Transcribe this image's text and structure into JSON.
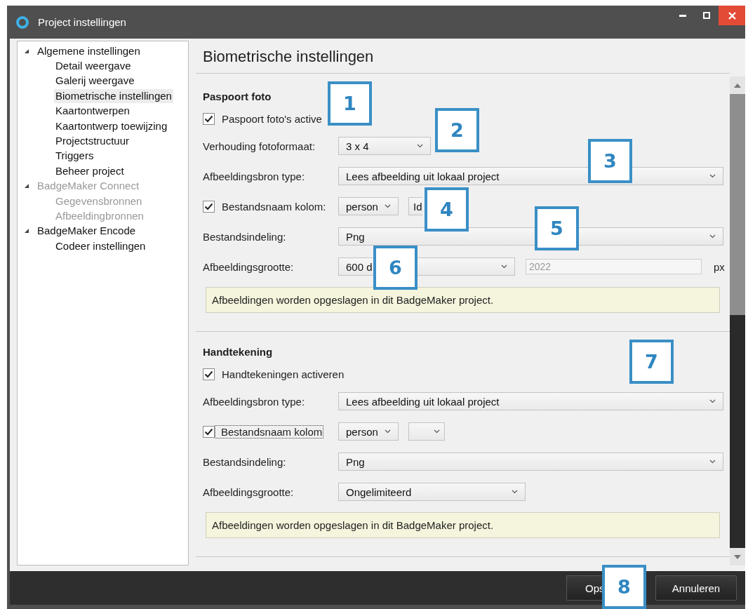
{
  "window": {
    "title": "Project instellingen"
  },
  "tree": [
    {
      "label": "Algemene instellingen",
      "expanded": true,
      "disabled": false,
      "selected": false,
      "children": [
        {
          "label": "Detail weergave",
          "disabled": false,
          "selected": false
        },
        {
          "label": "Galerij weergave",
          "disabled": false,
          "selected": false
        },
        {
          "label": "Biometrische instellingen",
          "disabled": false,
          "selected": true
        },
        {
          "label": "Kaartontwerpen",
          "disabled": false,
          "selected": false
        },
        {
          "label": "Kaartontwerp toewijzing",
          "disabled": false,
          "selected": false
        },
        {
          "label": "Projectstructuur",
          "disabled": false,
          "selected": false
        },
        {
          "label": "Triggers",
          "disabled": false,
          "selected": false
        },
        {
          "label": "Beheer project",
          "disabled": false,
          "selected": false
        }
      ]
    },
    {
      "label": "BadgeMaker Connect",
      "expanded": true,
      "disabled": true,
      "selected": false,
      "children": [
        {
          "label": "Gegevensbronnen",
          "disabled": true,
          "selected": false
        },
        {
          "label": "Afbeeldingbronnen",
          "disabled": true,
          "selected": false
        }
      ]
    },
    {
      "label": "BadgeMaker Encode",
      "expanded": true,
      "disabled": false,
      "selected": false,
      "children": [
        {
          "label": "Codeer instellingen",
          "disabled": false,
          "selected": false
        }
      ]
    }
  ],
  "heading": "Biometrische instellingen",
  "sections": [
    {
      "title": "Paspoort foto",
      "rows": [
        {
          "kind": "checkbox",
          "label": "Paspoort foto's active",
          "checked": true
        },
        {
          "kind": "short-select",
          "label": "Verhouding fotoformaat:",
          "value": "3 x 4"
        },
        {
          "kind": "wide-select",
          "label": "Afbeeldingsbron type:",
          "value": "Lees afbeelding uit lokaal project"
        },
        {
          "kind": "checkbox-select",
          "label": "Bestandsnaam kolom:",
          "checked": true,
          "focused": false,
          "selects": [
            {
              "kind": "filled",
              "value": "person"
            },
            {
              "kind": "filled",
              "value": "Id"
            }
          ]
        },
        {
          "kind": "wide-select",
          "label": "Bestandsindeling:",
          "value": "Png"
        },
        {
          "kind": "select-input",
          "label": "Afbeeldingsgrootte:",
          "value": "600 d",
          "input_value": "2022",
          "input_disabled": true,
          "unit": "px"
        },
        {
          "kind": "note",
          "text": "Afbeeldingen worden opgeslagen in dit BadgeMaker project."
        }
      ]
    },
    {
      "title": "Handtekening",
      "rows": [
        {
          "kind": "checkbox",
          "label": "Handtekeningen activeren",
          "checked": true
        },
        {
          "kind": "wide-select",
          "label": "Afbeeldingsbron type:",
          "value": "Lees afbeelding uit lokaal project"
        },
        {
          "kind": "checkbox-select",
          "label": "Bestandsnaam kolom",
          "checked": true,
          "focused": true,
          "selects": [
            {
              "kind": "filled",
              "value": "person"
            },
            {
              "kind": "blank"
            }
          ]
        },
        {
          "kind": "wide-select",
          "label": "Bestandsindeling:",
          "value": "Png"
        },
        {
          "kind": "medium-select",
          "label": "Afbeeldingsgrootte:",
          "value": "Ongelimiteerd"
        },
        {
          "kind": "note",
          "text": "Afbeeldingen worden opgeslagen in dit BadgeMaker project."
        }
      ]
    }
  ],
  "footer_buttons": [
    "Ops",
    "Annuleren"
  ],
  "callouts": [
    "1",
    "2",
    "3",
    "4",
    "5",
    "6",
    "7",
    "8"
  ]
}
